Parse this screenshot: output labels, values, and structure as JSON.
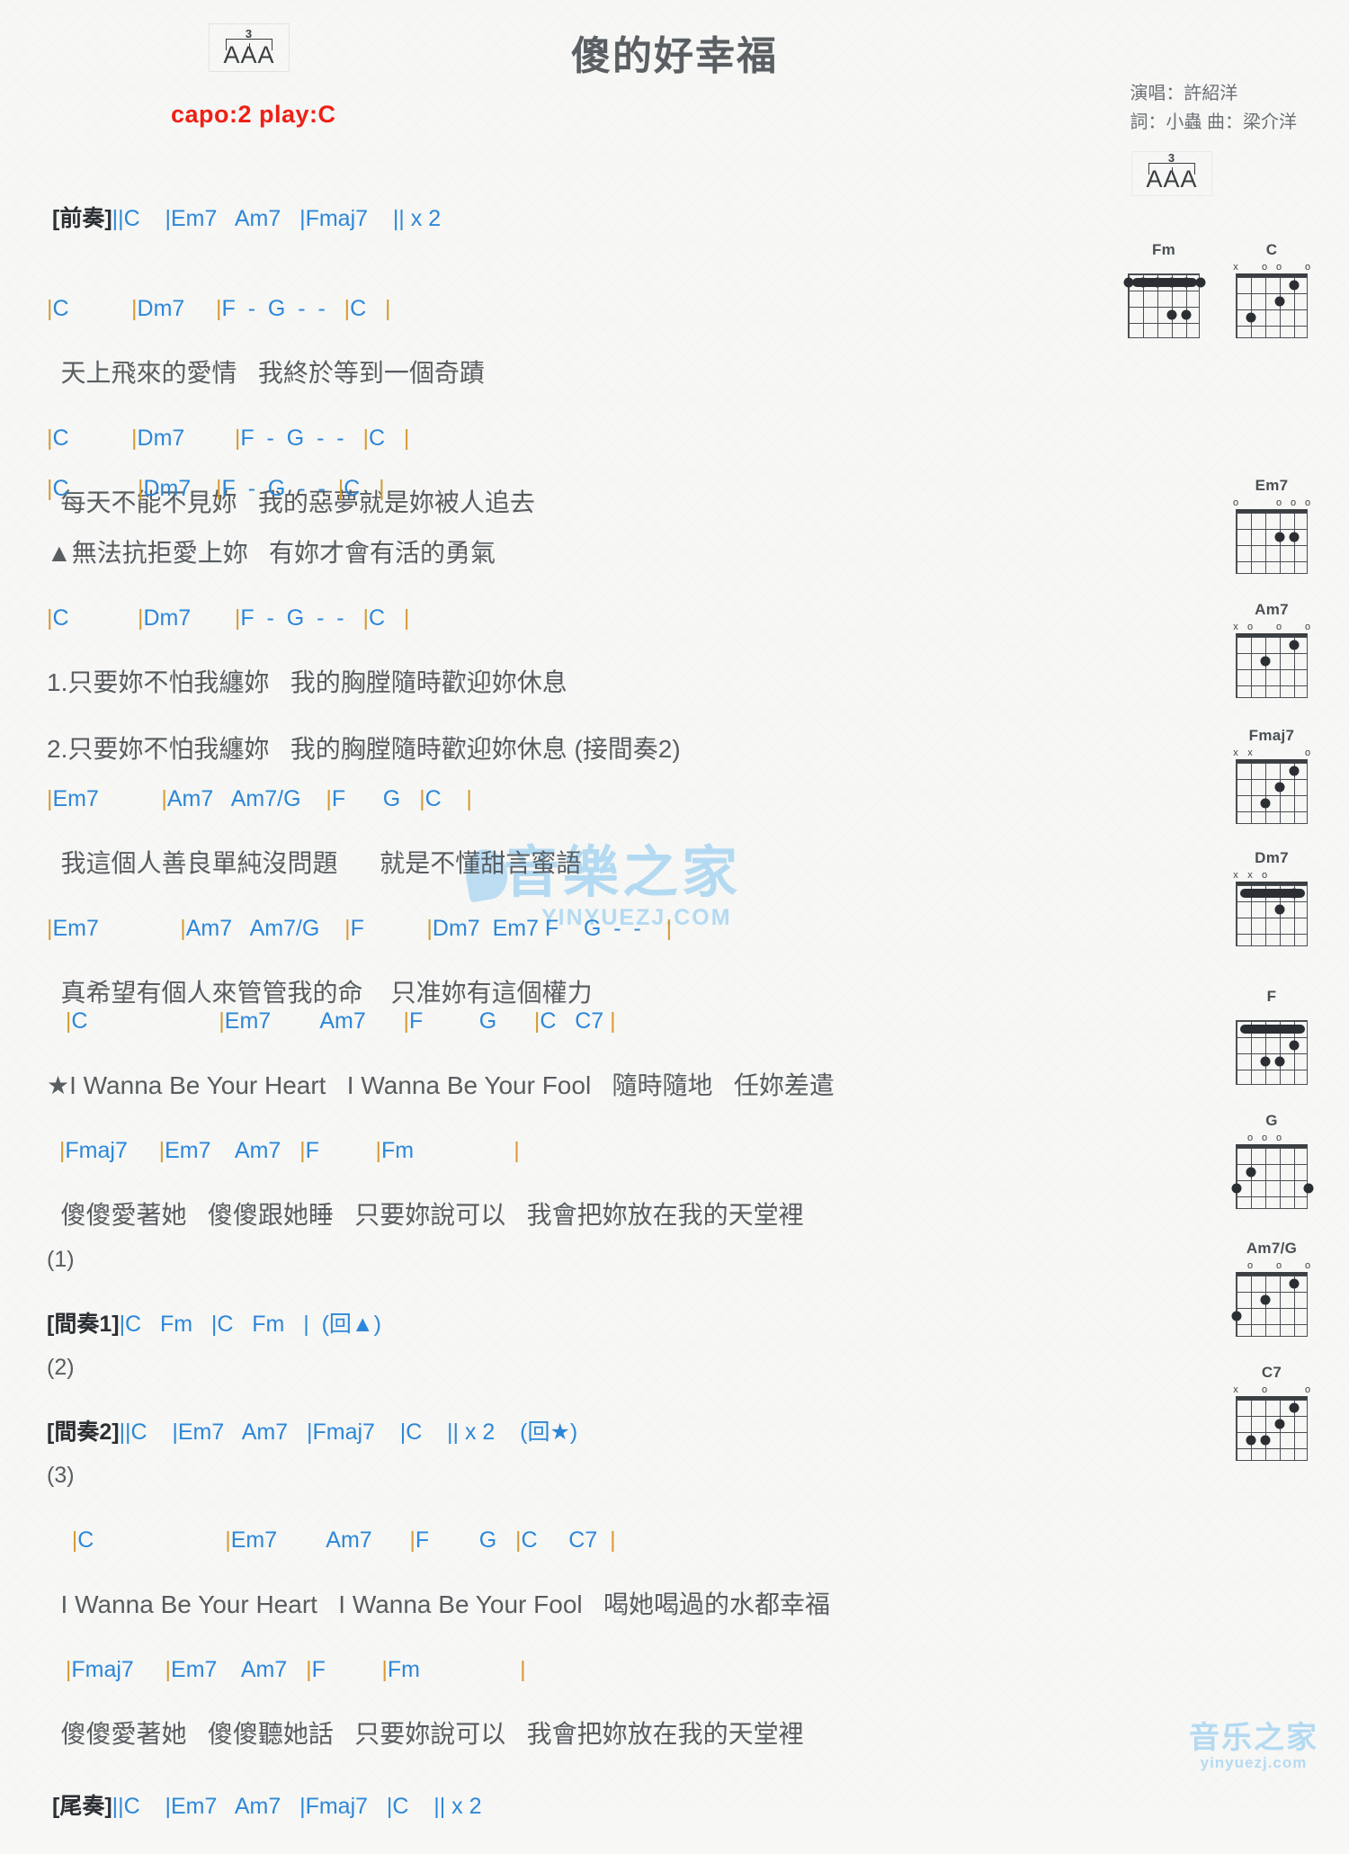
{
  "header": {
    "title": "傻的好幸福",
    "capo": "capo:2 play:C",
    "rhythm_label": "AAA",
    "rhythm_triplet": "3",
    "singer": "演唱：許紹洋",
    "writers": "詞：小蟲  曲：梁介洋"
  },
  "sections": {
    "intro": {
      "label": "[前奏]",
      "chords": "||C    |Em7   Am7   |Fmaj7    || x 2"
    },
    "verse1": [
      {
        "chords": "|C          |Dm7     |F  -  G  -  -   |C   |",
        "lyrics": "  天上飛來的愛情   我終於等到一個奇蹟"
      },
      {
        "chords": "|C          |Dm7        |F  -  G  -  -   |C   |",
        "lyrics": "  每天不能不見妳   我的惡夢就是妳被人追去"
      }
    ],
    "verse2": [
      {
        "chords": "|C           |Dm7    |F  -  G  -  -  |C   |",
        "lyrics": "▲無法抗拒愛上妳   有妳才會有活的勇氣"
      },
      {
        "chords": "|C           |Dm7       |F  -  G  -  -   |C   |",
        "lyrics": "1.只要妳不怕我纏妳   我的胸膛隨時歡迎妳休息"
      },
      {
        "chords": "",
        "lyrics": "2.只要妳不怕我纏妳   我的胸膛隨時歡迎妳休息 (接間奏2)"
      }
    ],
    "bridge": [
      {
        "chords": "|Em7          |Am7   Am7/G    |F      G   |C    |",
        "lyrics": "  我這個人善良單純沒問題      就是不懂甜言蜜語"
      },
      {
        "chords": "|Em7             |Am7   Am7/G    |F          |Dm7  Em7 F    G  -  -    |",
        "lyrics": "  真希望有個人來管管我的命    只准妳有這個權力"
      }
    ],
    "chorus1": [
      {
        "chords": "   |C                     |Em7        Am7      |F         G      |C   C7 |",
        "lyrics": "★I Wanna Be Your Heart   I Wanna Be Your Fool   隨時隨地   任妳差遣"
      },
      {
        "chords": "  |Fmaj7     |Em7    Am7   |F         |Fm                |",
        "lyrics": "  傻傻愛著她   傻傻跟她睡   只要妳說可以   我會把妳放在我的天堂裡"
      }
    ],
    "interlude1": {
      "number": "(1)",
      "label": "[間奏1]",
      "chords": "|C   Fm   |C   Fm   |  (回▲)"
    },
    "interlude2": {
      "number": "(2)",
      "label": "[間奏2]",
      "chords": "||C    |Em7   Am7   |Fmaj7    |C    || x 2    (回★)"
    },
    "chorus2": {
      "number": "(3)",
      "lines": [
        {
          "chords": "    |C                     |Em7        Am7      |F        G   |C     C7  |",
          "lyrics": "  I Wanna Be Your Heart   I Wanna Be Your Fool   喝她喝過的水都幸福"
        },
        {
          "chords": "   |Fmaj7     |Em7    Am7   |F         |Fm                |",
          "lyrics": "  傻傻愛著她   傻傻聽她話   只要妳說可以   我會把妳放在我的天堂裡"
        }
      ]
    },
    "outro": {
      "label": "[尾奏]",
      "chords": "||C    |Em7   Am7   |Fmaj7   |C    || x 2"
    }
  },
  "chord_diagrams": [
    {
      "name": "Fm",
      "open": "xx",
      "marks": [
        "",
        "",
        "",
        "",
        "",
        ""
      ],
      "nut": true
    },
    {
      "name": "C",
      "marks": [
        "x",
        "",
        "o",
        "o",
        "",
        "o"
      ],
      "nut": true
    },
    {
      "name": "Em7",
      "marks": [
        "o",
        "",
        "",
        "o",
        "o",
        "o"
      ],
      "nut": true
    },
    {
      "name": "Am7",
      "marks": [
        "x",
        "o",
        "",
        "o",
        "",
        "o"
      ],
      "nut": true
    },
    {
      "name": "Fmaj7",
      "marks": [
        "x",
        "x",
        "",
        "",
        "",
        "o"
      ],
      "nut": true
    },
    {
      "name": "Dm7",
      "marks": [
        "x",
        "x",
        "o",
        "",
        "",
        ""
      ],
      "nut": true
    },
    {
      "name": "F",
      "marks": [
        "",
        "",
        "",
        "",
        "",
        ""
      ],
      "nut": true
    },
    {
      "name": "G",
      "marks": [
        "",
        "o",
        "o",
        "o",
        "",
        ""
      ],
      "nut": true
    },
    {
      "name": "Am7/G",
      "marks": [
        "",
        "o",
        "",
        "o",
        "",
        "o"
      ],
      "nut": true
    },
    {
      "name": "C7",
      "marks": [
        "x",
        "",
        "o",
        "",
        "",
        "o"
      ],
      "nut": true
    }
  ],
  "watermark": {
    "main_cn": "音樂之家",
    "main_en": "YINYUEZJ.COM",
    "corner_cn": "音乐之家",
    "corner_en": "yinyuezj.com"
  }
}
